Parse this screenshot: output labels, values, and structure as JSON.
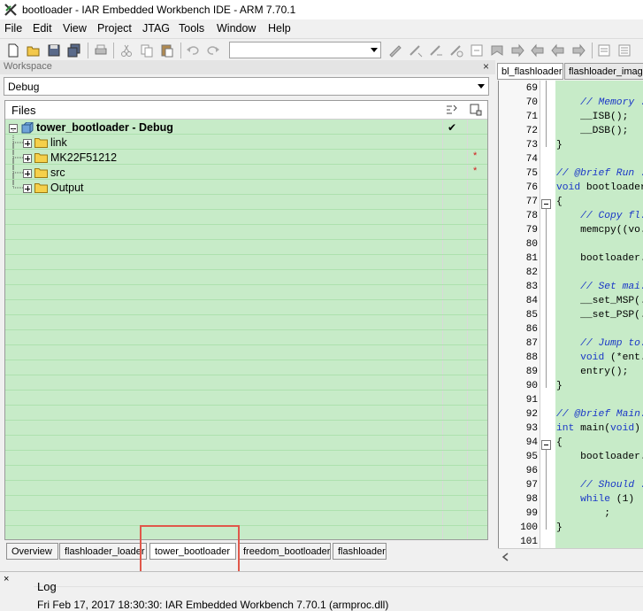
{
  "window": {
    "title": "bootloader - IAR Embedded Workbench IDE - ARM 7.70.1"
  },
  "menu": [
    "File",
    "Edit",
    "View",
    "Project",
    "JTAG",
    "Tools",
    "Window",
    "Help"
  ],
  "workspace": {
    "title": "Workspace",
    "close": "×",
    "configuration": "Debug",
    "files_header": "Files",
    "tree": [
      {
        "label": "tower_bootloader - Debug",
        "check": "✔"
      },
      {
        "label": "link",
        "mark": ""
      },
      {
        "label": "MK22F51212",
        "mark": "*"
      },
      {
        "label": "src",
        "mark": "*"
      },
      {
        "label": "Output",
        "mark": ""
      }
    ],
    "tabs": [
      "Overview",
      "flashloader_loader",
      "tower_bootloader",
      "freedom_bootloader",
      "flashloader"
    ],
    "active_tab": "tower_bootloader"
  },
  "editor": {
    "tabs": [
      "bl_flashloader",
      "flashloader_image"
    ],
    "lines": [
      {
        "n": "69",
        "text": ""
      },
      {
        "n": "70",
        "text": "    // Memory ..."
      },
      {
        "n": "71",
        "text": "    __ISB();"
      },
      {
        "n": "72",
        "text": "    __DSB();"
      },
      {
        "n": "73",
        "text": "}"
      },
      {
        "n": "74",
        "text": ""
      },
      {
        "n": "75",
        "text": "// @brief Run ..."
      },
      {
        "n": "76",
        "text": "void bootloader..."
      },
      {
        "n": "77",
        "text": "{"
      },
      {
        "n": "78",
        "text": "    // Copy fl..."
      },
      {
        "n": "79",
        "text": "    memcpy((vo..."
      },
      {
        "n": "80",
        "text": ""
      },
      {
        "n": "81",
        "text": "    bootloader..."
      },
      {
        "n": "82",
        "text": ""
      },
      {
        "n": "83",
        "text": "    // Set mai..."
      },
      {
        "n": "84",
        "text": "    __set_MSP(..."
      },
      {
        "n": "85",
        "text": "    __set_PSP(..."
      },
      {
        "n": "86",
        "text": ""
      },
      {
        "n": "87",
        "text": "    // Jump to..."
      },
      {
        "n": "88",
        "text": "    void (*ent..."
      },
      {
        "n": "89",
        "text": "    entry();"
      },
      {
        "n": "90",
        "text": "}"
      },
      {
        "n": "91",
        "text": ""
      },
      {
        "n": "92",
        "text": "// @brief Main..."
      },
      {
        "n": "93",
        "text": "int main(void)"
      },
      {
        "n": "94",
        "text": "{"
      },
      {
        "n": "95",
        "text": "    bootloader..."
      },
      {
        "n": "96",
        "text": ""
      },
      {
        "n": "97",
        "text": "    // Should ..."
      },
      {
        "n": "98",
        "text": "    while (1)"
      },
      {
        "n": "99",
        "text": "        ;"
      },
      {
        "n": "100",
        "text": "}"
      },
      {
        "n": "101",
        "text": ""
      }
    ]
  },
  "log": {
    "close": "×",
    "title": "Log",
    "line": "Fri Feb 17, 2017 18:30:30: IAR Embedded Workbench 7.70.1 (armproc.dll)"
  },
  "colors": {
    "panel_green": "#c7ebc8",
    "highlight": "#e0574a",
    "comment_blue": "#1a37c7"
  }
}
